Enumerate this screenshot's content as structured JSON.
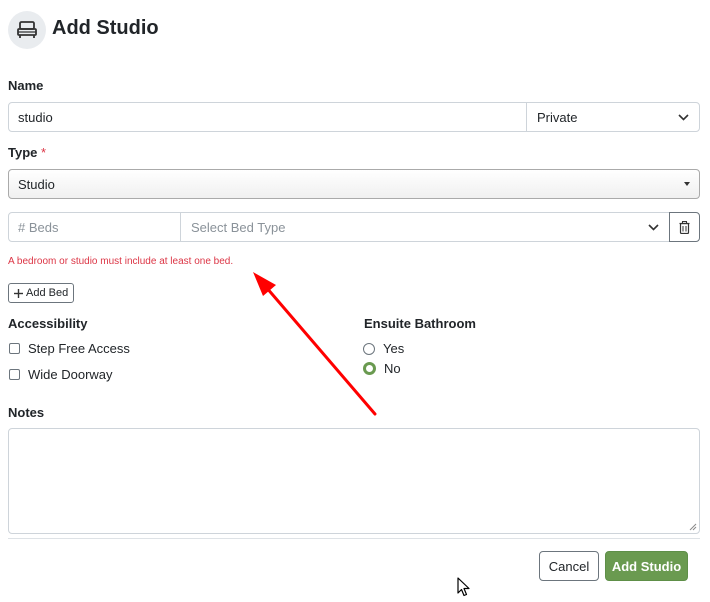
{
  "header": {
    "title": "Add Studio",
    "icon": "bed-icon"
  },
  "name": {
    "label": "Name",
    "value": "studio",
    "privacy_value": "Private"
  },
  "type": {
    "label": "Type",
    "required_marker": "*",
    "value": "Studio"
  },
  "bed": {
    "count_placeholder": "# Beds",
    "type_placeholder": "Select Bed Type",
    "delete_icon": "trash-icon"
  },
  "error": {
    "message": "A bedroom or studio must include at least one bed."
  },
  "add_bed": {
    "icon": "plus-icon",
    "label": "Add Bed"
  },
  "accessibility": {
    "heading": "Accessibility",
    "options": [
      {
        "label": "Step Free Access",
        "checked": false
      },
      {
        "label": "Wide Doorway",
        "checked": false
      }
    ]
  },
  "ensuite": {
    "heading": "Ensuite Bathroom",
    "options": [
      {
        "label": "Yes",
        "selected": false
      },
      {
        "label": "No",
        "selected": true
      }
    ]
  },
  "notes": {
    "label": "Notes",
    "value": ""
  },
  "footer": {
    "cancel_label": "Cancel",
    "submit_label": "Add Studio"
  },
  "colors": {
    "accent": "#6a9a50",
    "error": "#dc3545",
    "annotation": "#ff0000"
  }
}
